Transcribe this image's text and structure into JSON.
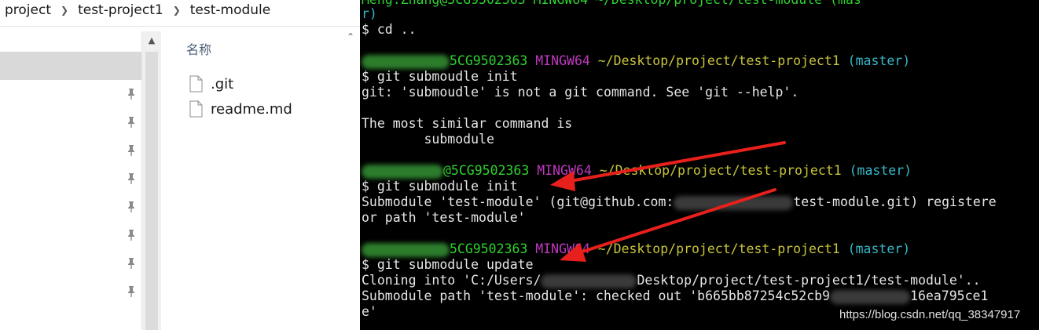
{
  "breadcrumb": {
    "items": [
      "project",
      "test-project1",
      "test-module"
    ],
    "separator_icon": "chevron-right-icon"
  },
  "nav_pane": {
    "pin_icon": "pin-icon",
    "pinned_count": 8
  },
  "file_list": {
    "column_header": "名称",
    "files": [
      {
        "name": ".git",
        "icon": "file-icon"
      },
      {
        "name": "readme.md",
        "icon": "file-icon"
      }
    ]
  },
  "terminal": {
    "top_partial": "Meng.Zhang@5CG9502363 MINGW64 ~/Desktop/project/test-module (mas",
    "wrap_r": "r)",
    "cmd_cd": "$ cd ..",
    "prompt1": {
      "host_suffix": "5CG9502363",
      "shell": "MINGW64",
      "path": "~/Desktop/project/test-project1",
      "branch": "(master)"
    },
    "cmd_typo": "$ git submoudle init",
    "err_line": "git: 'submoudle' is not a git command. See 'git --help'.",
    "similar_header": "The most similar command is",
    "similar_cmd": "        submodule",
    "prompt2": {
      "host_suffix": "@5CG9502363",
      "shell": "MINGW64",
      "path": "~/Desktop/project/test-project1",
      "branch": "(master)"
    },
    "cmd_init": "$ git submodule init",
    "reg_prefix": "Submodule 'test-module' (git@github.com:",
    "reg_suffix": "test-module.git) registere",
    "reg_wrap": "or path 'test-module'",
    "prompt3": {
      "host_suffix": "5CG9502363",
      "shell": "MINGW64",
      "path": "~/Desktop/project/test-project1",
      "branch": "(master)"
    },
    "cmd_update": "$ git submodule update",
    "clone_prefix": "Cloning into 'C:/Users/",
    "clone_suffix": "Desktop/project/test-project1/test-module'..",
    "path_prefix": "Submodule path 'test-module': checked out 'b665bb87254c52cb9",
    "path_suffix": "16ea795ce1",
    "path_wrap": "e'"
  },
  "watermark": "https://blog.csdn.net/qq_38347917",
  "colors": {
    "terminal_bg": "#000000",
    "prompt_user": "#2fd12f",
    "prompt_shell": "#c038c0",
    "prompt_path": "#c8c43a",
    "prompt_branch": "#36b8c8",
    "terminal_text": "#e6e6e6",
    "annotation_arrow": "#e8201c"
  }
}
